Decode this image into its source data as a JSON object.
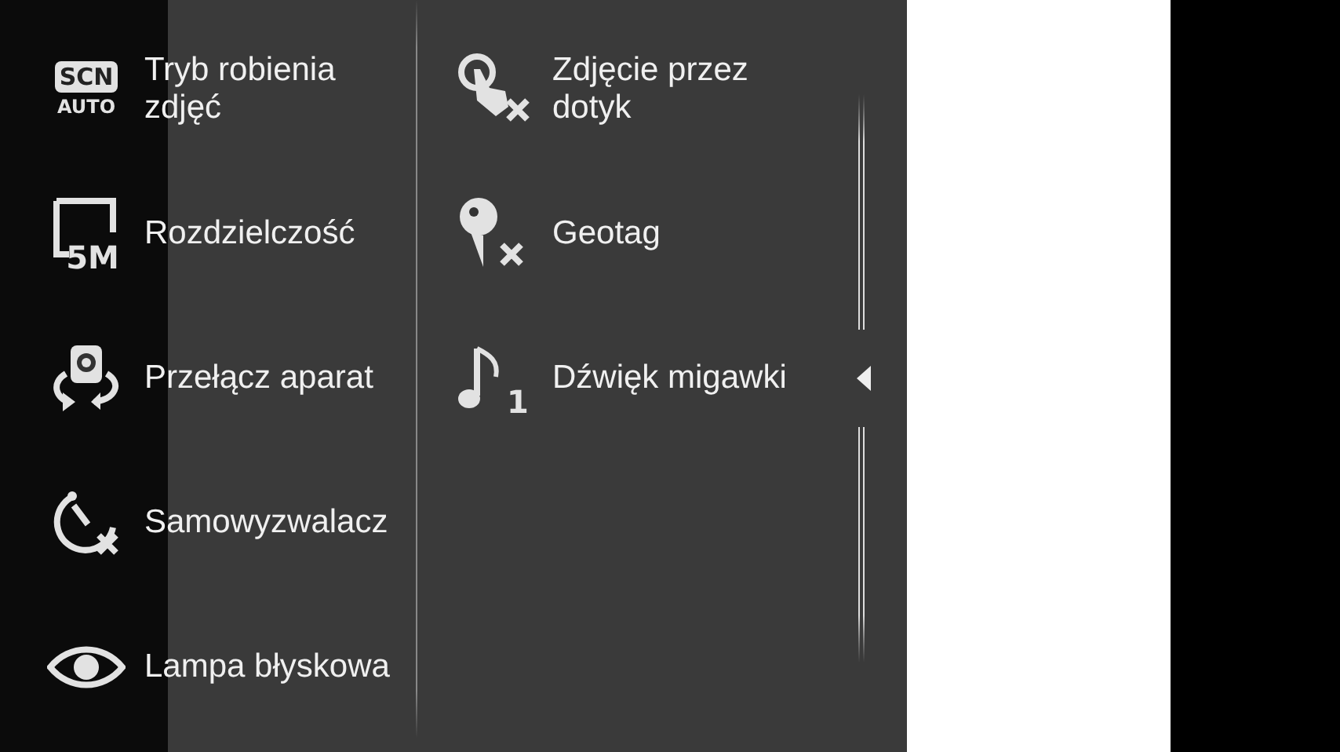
{
  "settings_columns": [
    {
      "items": [
        {
          "kind": "scene",
          "icon_text": [
            "SCN",
            "AUTO"
          ],
          "label": "Tryb robienia zdjęć"
        },
        {
          "kind": "resolution",
          "icon_text": [
            "5M"
          ],
          "label": "Rozdzielczość"
        },
        {
          "kind": "camera",
          "label": "Przełącz aparat"
        },
        {
          "kind": "timer",
          "label": "Samowyzwalacz"
        },
        {
          "kind": "flash",
          "label": "Lampa błyskowa"
        }
      ]
    },
    {
      "items": [
        {
          "kind": "touch",
          "label": "Zdjęcie przez dotyk"
        },
        {
          "kind": "geotag",
          "label": "Geotag"
        },
        {
          "kind": "sound",
          "icon_text": [
            "1"
          ],
          "label": "Dźwięk migawki"
        }
      ]
    }
  ]
}
